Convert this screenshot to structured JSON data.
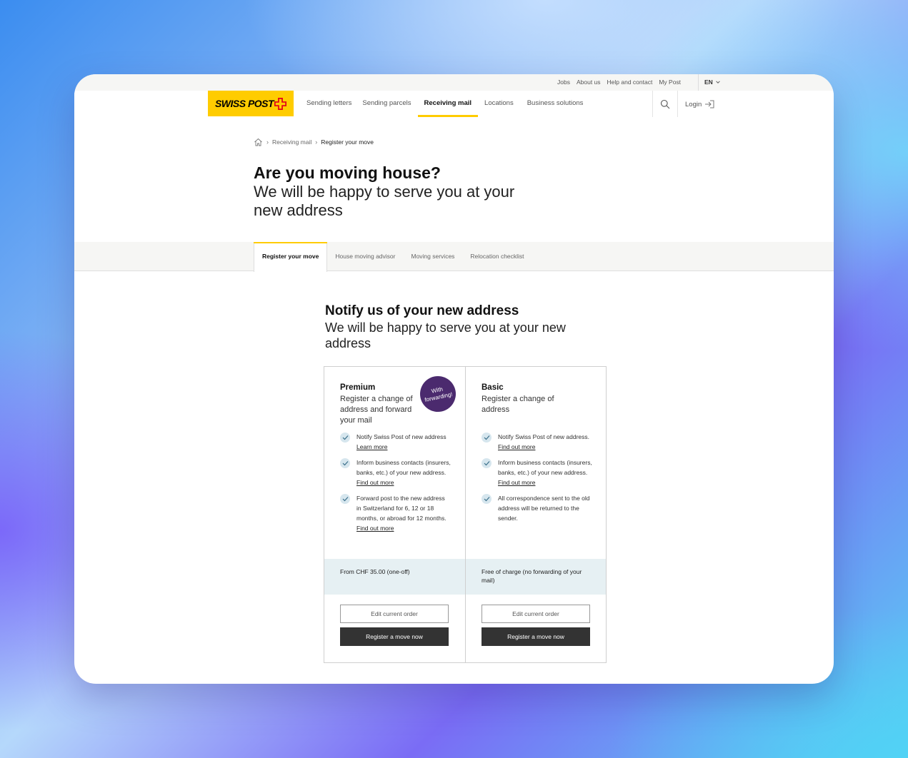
{
  "utility_bar": {
    "links": [
      "Jobs",
      "About us",
      "Help and contact",
      "My Post"
    ],
    "language": "EN"
  },
  "nav": {
    "logo_text": "SWISS POST",
    "items": [
      {
        "label": "Sending letters"
      },
      {
        "label": "Sending parcels"
      },
      {
        "label": "Receiving mail"
      },
      {
        "label": "Locations"
      },
      {
        "label": "Business solutions"
      }
    ],
    "active_item": "Receiving mail",
    "login_label": "Login"
  },
  "breadcrumb": {
    "items": [
      "Receiving mail",
      "Register your move"
    ]
  },
  "hero": {
    "title": "Are you moving house?",
    "subtitle": "We will be happy to serve you at your new address"
  },
  "tabs": {
    "items": [
      "Register your move",
      "House moving advisor",
      "Moving services",
      "Relocation checklist"
    ],
    "active": "Register your move"
  },
  "section": {
    "title": "Notify us of your new address",
    "subtitle": "We will be happy to serve you at your new address"
  },
  "cards": {
    "premium": {
      "title": "Premium",
      "description": "Register a change of address and forward your mail",
      "badge": "With forwarding!",
      "features": [
        {
          "text": "Notify Swiss Post of new address ",
          "link": "Learn more"
        },
        {
          "text": "Inform business contacts (insurers, banks, etc.) of your new address. ",
          "link": "Find out more"
        },
        {
          "text": "Forward post to the new address in Switzerland for 6, 12 or 18 months, or abroad for 12 months. ",
          "link": "Find out more"
        }
      ],
      "price": "From CHF 35.00 (one-off)",
      "edit_label": "Edit current order",
      "register_label": "Register a move now"
    },
    "basic": {
      "title": "Basic",
      "description": "Register a change of address",
      "features": [
        {
          "text": "Notify Swiss Post of new address. ",
          "link": "Find out more"
        },
        {
          "text": "Inform business contacts (insurers, banks, etc.) of your new address. ",
          "link": "Find out more"
        },
        {
          "text": "All correspondence sent to the old address will be returned to the sender.",
          "link": ""
        }
      ],
      "price": "Free of charge (no forwarding of your mail)",
      "edit_label": "Edit current order",
      "register_label": "Register a move now"
    }
  },
  "colors": {
    "brand_yellow": "#ffcc00",
    "badge_purple": "#4b2a6e",
    "price_bg": "#e6f0f3",
    "button_dark": "#333333"
  }
}
